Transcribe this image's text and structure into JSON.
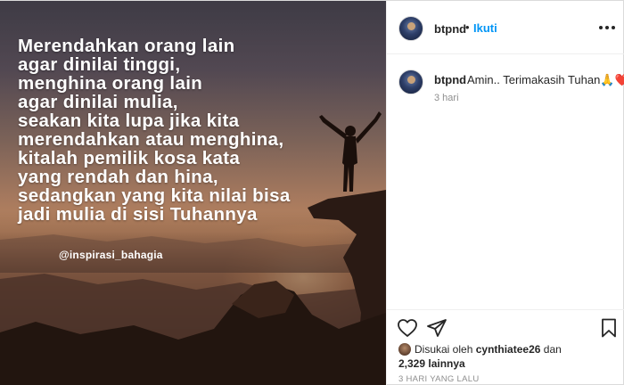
{
  "post": {
    "quote_lines": [
      "Merendahkan orang lain",
      "agar dinilai tinggi,",
      "menghina orang lain",
      "agar dinilai mulia,",
      "seakan kita lupa jika kita",
      "merendahkan atau menghina,",
      "kitalah pemilik kosa kata",
      "yang rendah dan hina,",
      "sedangkan yang kita nilai bisa",
      "jadi mulia di sisi Tuhannya"
    ],
    "image_handle": "@inspirasi_bahagia"
  },
  "header": {
    "username": "btpnd",
    "separator": "•",
    "follow_label": "Ikuti",
    "more_icon": "more-options-icon"
  },
  "caption": {
    "username": "btpnd",
    "text": "Amin.. Terimakasih Tuhan🙏❤️",
    "time": "3 hari"
  },
  "actions": {
    "like_icon": "heart-icon",
    "share_icon": "share-icon",
    "save_icon": "bookmark-icon"
  },
  "likes": {
    "prefix": "Disukai oleh",
    "user": "cynthiatee26",
    "conj": "dan",
    "count": "2,329 lainnya"
  },
  "timestamp": "3 HARI YANG LALU",
  "colors": {
    "accent_link": "#0095f6",
    "text": "#262626",
    "muted": "#8e8e8e"
  }
}
